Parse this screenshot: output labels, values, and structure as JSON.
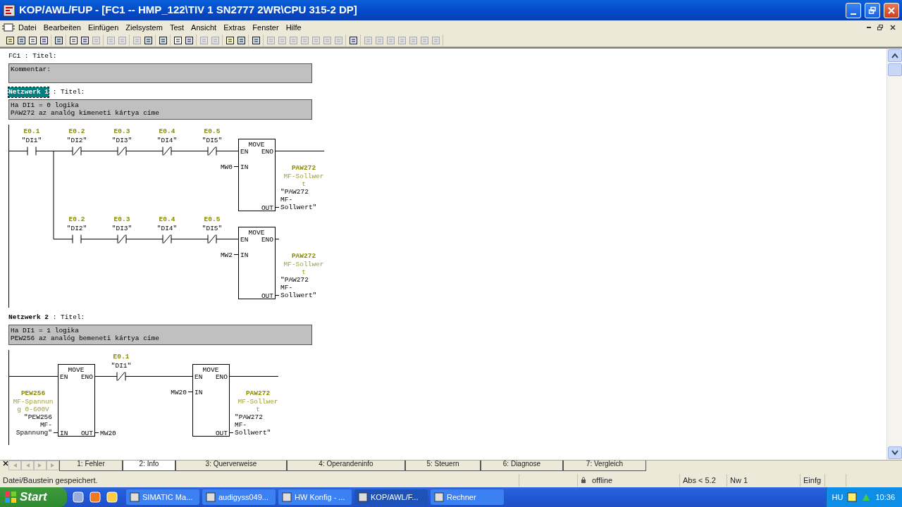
{
  "window": {
    "title": "KOP/AWL/FUP  - [FC1 -- HMP_122\\TIV 1 SN2777 2WR\\CPU 315-2 DP]"
  },
  "menu": [
    "Datei",
    "Bearbeiten",
    "Einfügen",
    "Zielsystem",
    "Test",
    "Ansicht",
    "Extras",
    "Fenster",
    "Hilfe"
  ],
  "toolbar": [
    {
      "buttons": [
        {
          "disabled": false
        },
        {
          "disabled": false
        },
        {
          "disabled": false
        },
        {
          "disabled": false
        }
      ]
    },
    {
      "buttons": [
        {
          "disabled": false
        }
      ]
    },
    {
      "buttons": [
        {
          "disabled": false
        },
        {
          "disabled": false
        },
        {
          "disabled": true
        }
      ]
    },
    {
      "buttons": [
        {
          "disabled": true
        },
        {
          "disabled": true
        }
      ]
    },
    {
      "buttons": [
        {
          "disabled": true
        },
        {
          "disabled": false
        }
      ]
    },
    {
      "buttons": [
        {
          "disabled": false
        }
      ]
    },
    {
      "buttons": [
        {
          "disabled": false
        },
        {
          "disabled": false
        }
      ]
    },
    {
      "buttons": [
        {
          "disabled": true
        },
        {
          "disabled": true
        }
      ]
    },
    {
      "buttons": [
        {
          "disabled": false
        },
        {
          "disabled": false
        }
      ]
    },
    {
      "buttons": [
        {
          "disabled": false
        }
      ]
    },
    {
      "buttons": [
        {
          "disabled": true
        },
        {
          "disabled": true
        },
        {
          "disabled": true
        },
        {
          "disabled": true
        },
        {
          "disabled": true
        },
        {
          "disabled": true
        },
        {
          "disabled": true
        }
      ]
    },
    {
      "buttons": [
        {
          "disabled": false
        }
      ]
    },
    {
      "buttons": [
        {
          "disabled": true
        },
        {
          "disabled": true
        },
        {
          "disabled": true
        },
        {
          "disabled": true
        },
        {
          "disabled": true
        },
        {
          "disabled": true
        },
        {
          "disabled": true
        }
      ]
    }
  ],
  "block": {
    "name": "FC1",
    "title_label": ": Titel:",
    "comment": [
      "Kommentar:"
    ]
  },
  "networks": [
    {
      "label": "Netzwerk 1",
      "selected": true,
      "title_label": ": Titel:",
      "comment": [
        "Ha DI1 = 0 logika",
        "PAW272 az analóg kimeneti kártya címe"
      ],
      "rungs": [
        {
          "kind": "main",
          "elements": [
            {
              "kind": "contact",
              "negated": false,
              "address": "E0.1",
              "symbol": "\"DI1\""
            },
            {
              "kind": "contact",
              "negated": true,
              "address": "E0.2",
              "symbol": "\"DI2\""
            },
            {
              "kind": "contact",
              "negated": true,
              "address": "E0.3",
              "symbol": "\"DI3\""
            },
            {
              "kind": "contact",
              "negated": true,
              "address": "E0.4",
              "symbol": "\"DI4\""
            },
            {
              "kind": "contact",
              "negated": true,
              "address": "E0.5",
              "symbol": "\"DI5\""
            },
            {
              "kind": "box",
              "name": "MOVE",
              "pins": {
                "en": "EN",
                "eno": "ENO",
                "in": "IN",
                "out": "OUT"
              },
              "input": {
                "address": "MW0"
              },
              "output": {
                "address": "PAW272",
                "comment": [
                  "MF-Sollwer",
                  "t"
                ],
                "symbol": [
                  "\"PAW272",
                  "MF-",
                  "Sollwert\""
                ]
              }
            }
          ]
        },
        {
          "kind": "branch",
          "elements": [
            {
              "kind": "contact",
              "negated": false,
              "address": "E0.2",
              "symbol": "\"DI2\""
            },
            {
              "kind": "contact",
              "negated": true,
              "address": "E0.3",
              "symbol": "\"DI3\""
            },
            {
              "kind": "contact",
              "negated": true,
              "address": "E0.4",
              "symbol": "\"DI4\""
            },
            {
              "kind": "contact",
              "negated": true,
              "address": "E0.5",
              "symbol": "\"DI5\""
            },
            {
              "kind": "box",
              "name": "MOVE",
              "pins": {
                "en": "EN",
                "eno": "ENO",
                "in": "IN",
                "out": "OUT"
              },
              "input": {
                "address": "MW2"
              },
              "output": {
                "address": "PAW272",
                "comment": [
                  "MF-Sollwer",
                  "t"
                ],
                "symbol": [
                  "\"PAW272",
                  "MF-",
                  "Sollwert\""
                ]
              }
            }
          ]
        }
      ]
    },
    {
      "label": "Netzwerk 2",
      "selected": false,
      "title_label": ": Titel:",
      "comment": [
        "Ha DI1 = 1 logika",
        "PEW256 az analóg bemeneti kártya címe"
      ],
      "rungs": [
        {
          "kind": "main",
          "elements": [
            {
              "kind": "box",
              "name": "MOVE",
              "pins": {
                "en": "EN",
                "eno": "ENO",
                "in": "IN",
                "out": "OUT"
              },
              "input": {
                "address": "PEW256",
                "comment": [
                  "MF-Spannun",
                  "g 0-600V"
                ],
                "symbol": [
                  "\"PEW256",
                  "MF-",
                  "Spannung\""
                ]
              },
              "output": {
                "address": "MW20"
              }
            },
            {
              "kind": "contact",
              "negated": true,
              "address": "E0.1",
              "symbol": "\"DI1\""
            },
            {
              "kind": "box",
              "name": "MOVE",
              "pins": {
                "en": "EN",
                "eno": "ENO",
                "in": "IN",
                "out": "OUT"
              },
              "input": {
                "address": "MW20"
              },
              "output": {
                "address": "PAW272",
                "comment": [
                  "MF-Sollwer",
                  "t"
                ],
                "symbol": [
                  "\"PAW272",
                  "MF-",
                  "Sollwert\""
                ]
              }
            }
          ]
        }
      ]
    }
  ],
  "tabs": [
    {
      "label": "1: Fehler",
      "selected": false
    },
    {
      "label": "2: Info",
      "selected": true
    },
    {
      "label": "3: Querverweise",
      "selected": false
    },
    {
      "label": "4: Operandeninfo",
      "selected": false
    },
    {
      "label": "5: Steuern",
      "selected": false
    },
    {
      "label": "6: Diagnose",
      "selected": false
    },
    {
      "label": "7: Vergleich",
      "selected": false
    }
  ],
  "status_bar": {
    "message": "Datei/Baustein gespeichert.",
    "mode": "offline",
    "position": "Abs < 5.2",
    "network": "Nw 1",
    "insert": "Einfg"
  },
  "taskbar": {
    "start": "Start",
    "tasks": [
      {
        "label": "SIMATIC Ma...",
        "selected": false
      },
      {
        "label": "audigyss049...",
        "selected": false
      },
      {
        "label": "HW Konfig - ...",
        "selected": false
      },
      {
        "label": "KOP/AWL/F...",
        "selected": true
      },
      {
        "label": "Rechner",
        "selected": false
      }
    ],
    "language": "HU",
    "clock": "10:36"
  }
}
